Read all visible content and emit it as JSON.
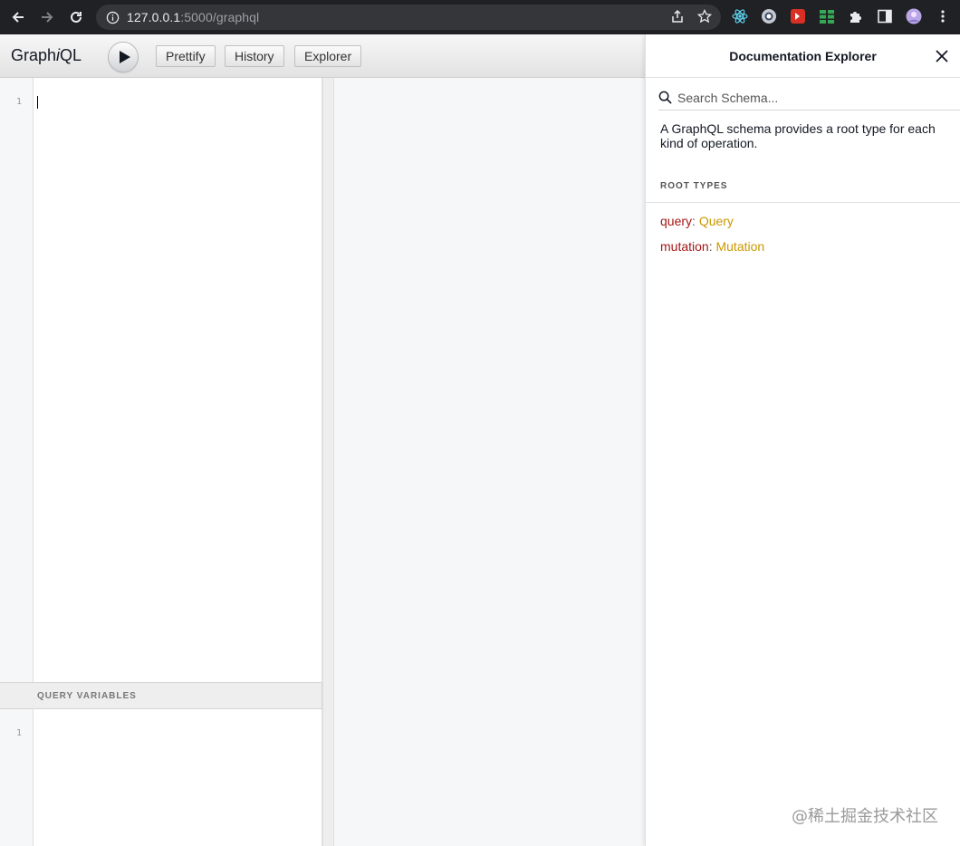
{
  "browser": {
    "url_host": "127.0.0.1",
    "url_path": ":5000/graphql"
  },
  "toolbar": {
    "title_prefix": "Graph",
    "title_italic": "i",
    "title_suffix": "QL",
    "prettify_label": "Prettify",
    "history_label": "History",
    "explorer_label": "Explorer"
  },
  "editor": {
    "query_line_number": "1",
    "variables_title": "QUERY VARIABLES",
    "variables_line_number": "1"
  },
  "docs": {
    "title": "Documentation Explorer",
    "search_placeholder": "Search Schema...",
    "description": "A GraphQL schema provides a root type for each kind of operation.",
    "section_title": "ROOT TYPES",
    "root_types": [
      {
        "name": "query",
        "type": "Query"
      },
      {
        "name": "mutation",
        "type": "Mutation"
      }
    ]
  },
  "watermark": "@稀土掘金技术社区",
  "colors": {
    "field_name": "#a61717",
    "type_name": "#ca9800",
    "chrome_bg": "#202124"
  },
  "icons": {
    "back": "arrow-left-icon",
    "forward": "arrow-right-icon",
    "reload": "reload-icon",
    "site_info": "info-icon",
    "share": "share-icon",
    "bookmark": "star-icon",
    "run": "play-icon",
    "search": "search-icon",
    "close": "close-icon"
  }
}
